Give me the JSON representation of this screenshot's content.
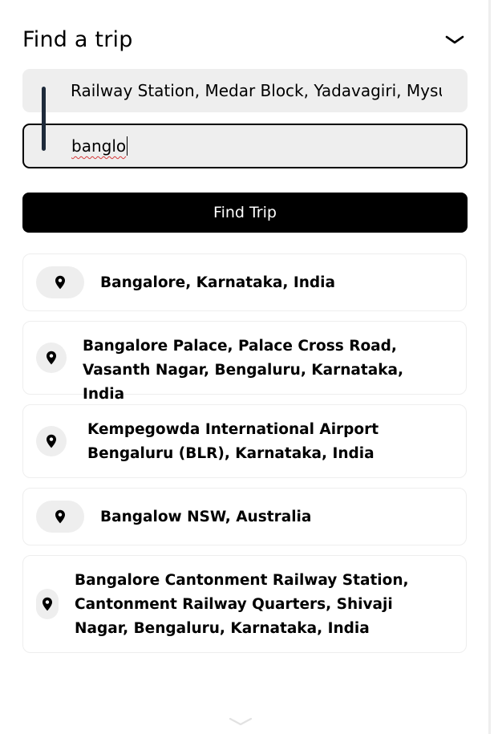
{
  "header": {
    "title": "Find a trip",
    "collapse_icon": "chevron-down-icon"
  },
  "trip": {
    "from_value": "Railway Station, Medar Block, Yadavagiri, Mysuru",
    "to_value": "banglo"
  },
  "find_button_label": "Find Trip",
  "suggestions": [
    {
      "text": "Bangalore, Karnataka, India",
      "icon": "location-pin-icon"
    },
    {
      "text": "Bangalore Palace, Palace Cross Road, Vasanth Nagar, Bengaluru, Karnataka, India",
      "icon": "location-pin-icon"
    },
    {
      "text": "Kempegowda International Airport Bengaluru (BLR), Karnataka, India",
      "icon": "location-pin-icon"
    },
    {
      "text": "Bangalow NSW, Australia",
      "icon": "location-pin-icon"
    },
    {
      "text": "Bangalore Cantonment Railway Station, Cantonment Railway Quarters, Shivaji Nagar, Bengaluru, Karnataka, India",
      "icon": "location-pin-icon"
    }
  ],
  "colors": {
    "accent": "#000000",
    "field_bg": "#eeeeee",
    "connector": "#1e2a3a"
  }
}
